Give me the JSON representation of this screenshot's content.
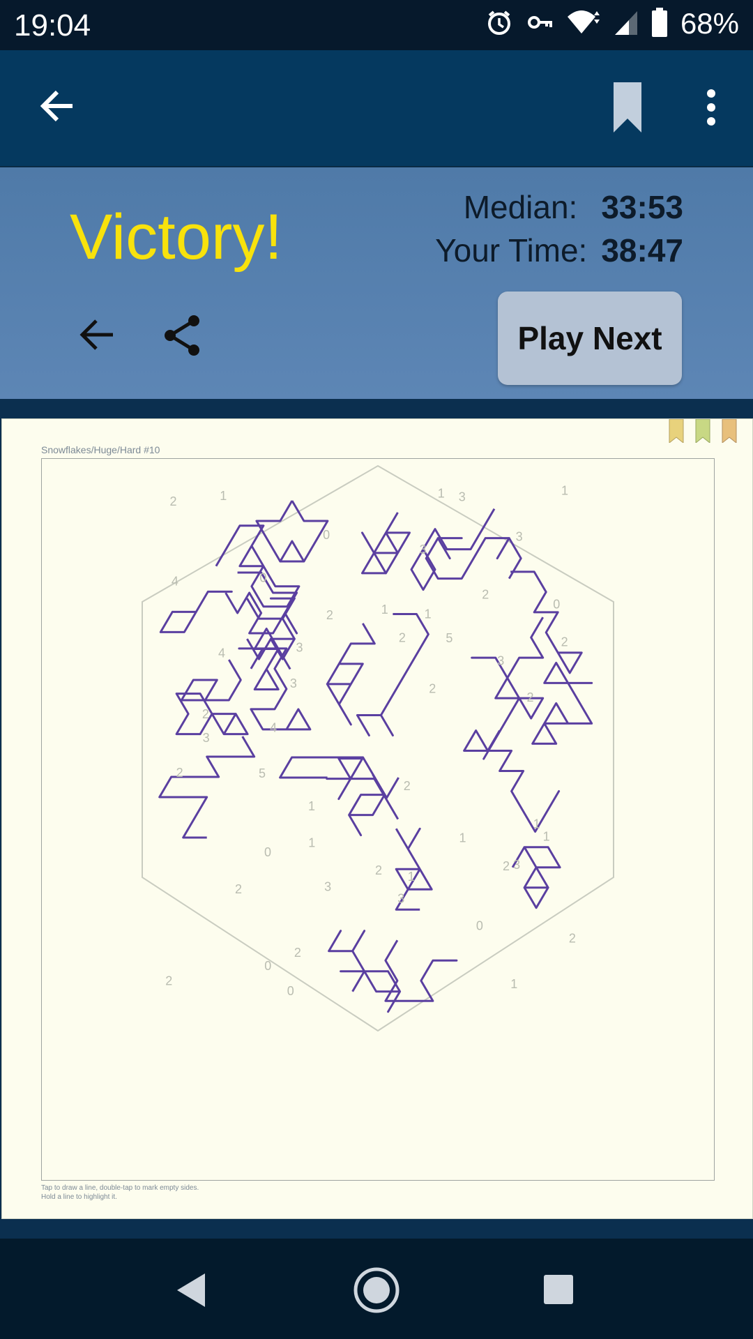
{
  "status": {
    "time": "19:04",
    "battery": "68%"
  },
  "header": {
    "back_icon": "arrow-left-icon",
    "bookmark_icon": "bookmark-icon",
    "more_icon": "more-vert-icon"
  },
  "result": {
    "title": "Victory!",
    "median_label": "Median:",
    "median_value": "33:53",
    "your_time_label": "Your Time:",
    "your_time_value": "38:47",
    "play_next_label": "Play Next"
  },
  "puzzle": {
    "name": "Snowflakes/Huge/Hard #10",
    "hint_line1": "Tap to draw a line, double-tap to mark empty sides.",
    "hint_line2": "Hold a line to highlight it.",
    "ribbon_colors": [
      "#e8d27c",
      "#c8d884",
      "#e8c07c"
    ],
    "line_color": "#5a3fa0",
    "clue_numbers": [
      "0",
      "3",
      "1",
      "2",
      "3",
      "2",
      "2",
      "1",
      "2",
      "0",
      "1",
      "2",
      "1",
      "0",
      "0",
      "2",
      "3",
      "1",
      "0",
      "1",
      "4",
      "0",
      "2",
      "5",
      "3",
      "4",
      "3",
      "2",
      "1",
      "2",
      "1",
      "3",
      "4",
      "2",
      "1",
      "2",
      "0",
      "5",
      "3",
      "2",
      "2",
      "1",
      "3",
      "1",
      "2",
      "1",
      "3",
      "2",
      "2",
      "3"
    ]
  },
  "colors": {
    "accent": "#f8e20c",
    "appbar": "#05395f",
    "panel": "#5a83b1",
    "board": "#fdfdee"
  }
}
